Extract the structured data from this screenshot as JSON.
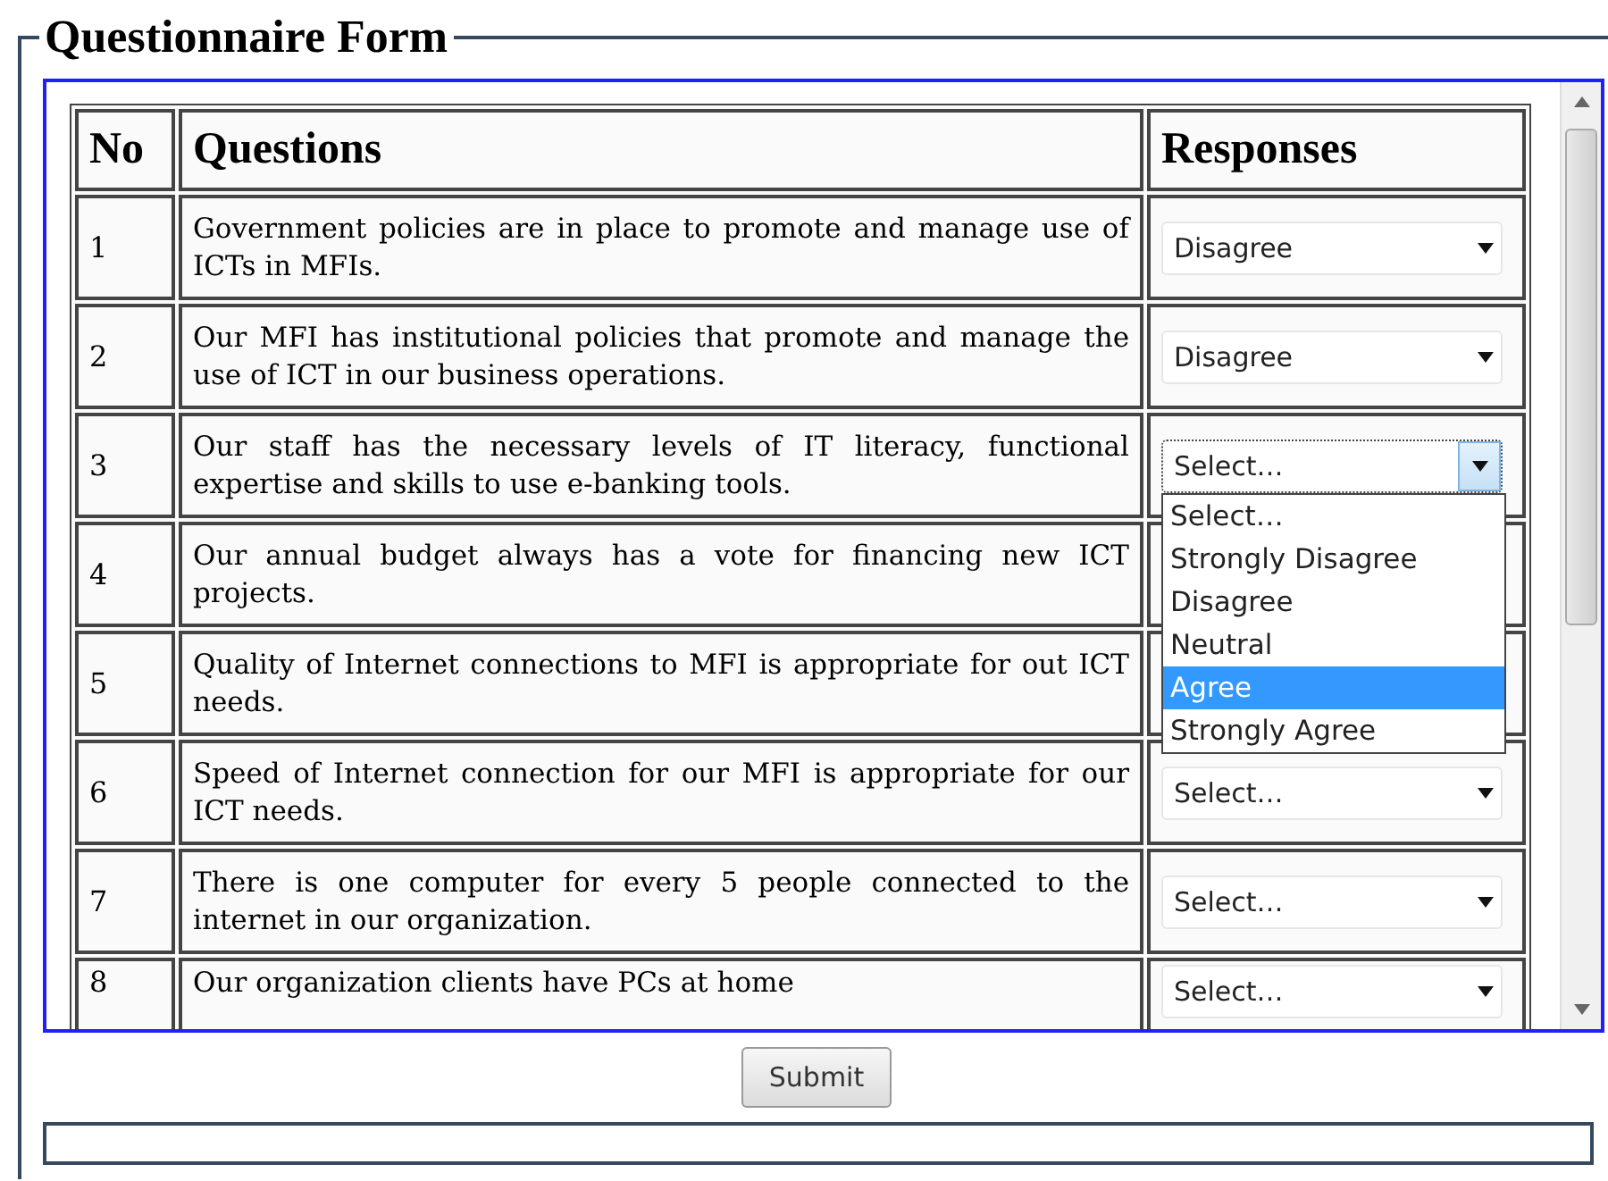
{
  "form": {
    "legend": "Questionnaire Form"
  },
  "table": {
    "columns": [
      "No",
      "Questions",
      "Responses"
    ],
    "rows": [
      {
        "no": "1",
        "question": "Government policies are in place to promote and manage use of ICTs in MFIs.",
        "response": "Disagree",
        "expanded": false
      },
      {
        "no": "2",
        "question": "Our MFI has institutional policies that promote and manage the use of ICT in our business operations.",
        "response": "Disagree",
        "expanded": false
      },
      {
        "no": "3",
        "question": "Our staff has the necessary levels of IT literacy, functional expertise and skills to use e-banking tools.",
        "response": "Select…",
        "expanded": true,
        "options": [
          {
            "label": "Select…",
            "selected": false
          },
          {
            "label": "Strongly Disagree",
            "selected": false
          },
          {
            "label": "Disagree",
            "selected": false
          },
          {
            "label": "Neutral",
            "selected": false
          },
          {
            "label": "Agree",
            "selected": true
          },
          {
            "label": "Strongly Agree",
            "selected": false
          }
        ]
      },
      {
        "no": "4",
        "question": "Our annual budget always has a vote for financing new ICT projects."
      },
      {
        "no": "5",
        "question": "Quality of Internet connections to MFI is appropriate for out ICT needs."
      },
      {
        "no": "6",
        "question": "Speed of Internet connection for our MFI is appropriate for our ICT needs.",
        "response": "Select…",
        "expanded": false
      },
      {
        "no": "7",
        "question": "There is one computer for every 5 people connected to the internet in our organization.",
        "response": "Select…",
        "expanded": false
      },
      {
        "no": "8",
        "question": "Our organization clients have PCs at home",
        "response": "Select…",
        "expanded": false
      }
    ]
  },
  "submit": {
    "label": "Submit"
  }
}
